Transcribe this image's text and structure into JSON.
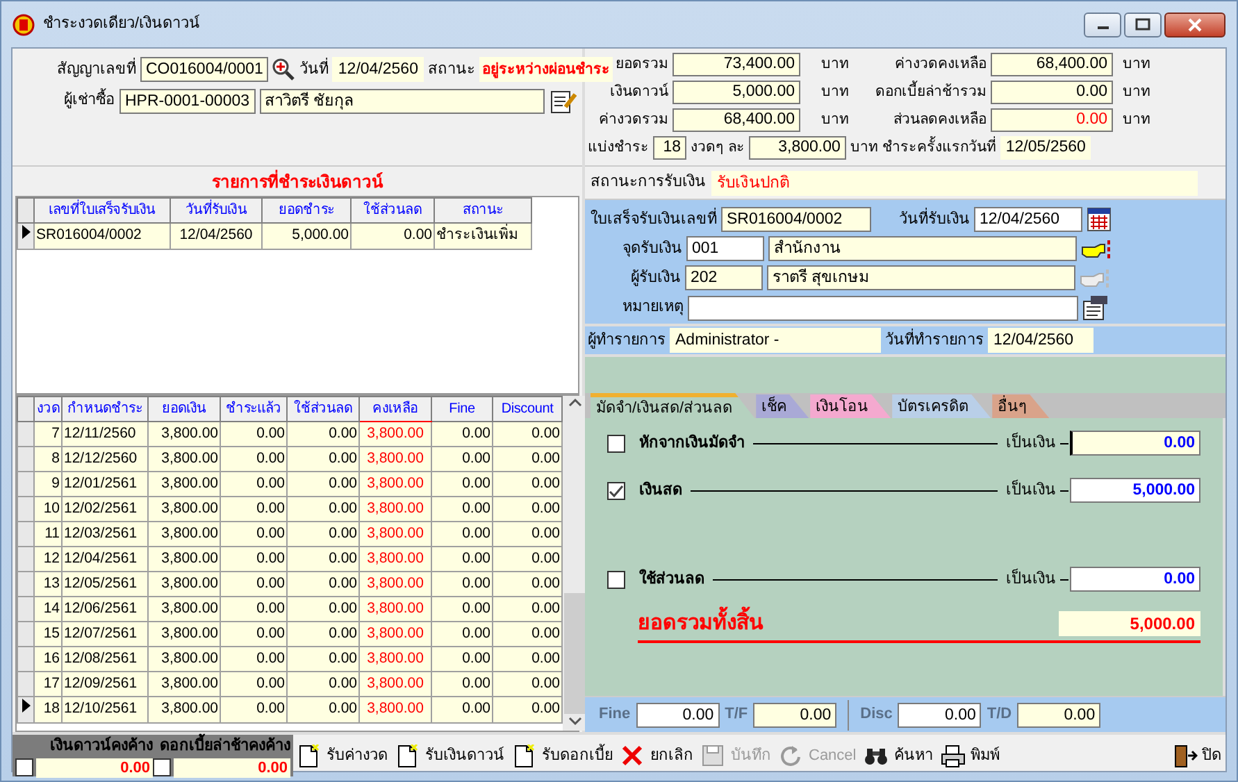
{
  "window": {
    "title": "ชำระงวดเดียว/เงินดาวน์"
  },
  "contract": {
    "number_label": "สัญญาเลขที่",
    "number": "CO016004/0001",
    "date_label": "วันที่",
    "date": "12/04/2560",
    "status_label": "สถานะ",
    "status": "อยู่ระหว่างผ่อนชำระ",
    "buyer_label": "ผู้เช่าซื้อ",
    "buyer_code": "HPR-0001-00003",
    "buyer_name": "สาวิตรี  ชัยกุล"
  },
  "totals": [
    {
      "label": "ยอดรวม",
      "value": "73,400.00",
      "unit": "บาท",
      "alert": false
    },
    {
      "label": "ค่างวดคงเหลือ",
      "value": "68,400.00",
      "unit": "บาท",
      "alert": false
    },
    {
      "label": "เงินดาวน์",
      "value": "5,000.00",
      "unit": "บาท",
      "alert": false
    },
    {
      "label": "ดอกเบี้ยล่าช้ารวม",
      "value": "0.00",
      "unit": "บาท",
      "alert": false
    },
    {
      "label": "ค่างวดรวม",
      "value": "68,400.00",
      "unit": "บาท",
      "alert": false
    },
    {
      "label": "ส่วนลดคงเหลือ",
      "value": "0.00",
      "unit": "บาท",
      "alert": true
    }
  ],
  "plan": {
    "label": "แบ่งชำระ",
    "count": "18",
    "each_label": "งวดๆ ละ",
    "amount": "3,800.00",
    "first_label": "บาท ชำระครั้งแรกวันที่",
    "first_date": "12/05/2560"
  },
  "payments": {
    "title": "รายการที่ชำระเงินดาวน์",
    "columns": [
      "เลขที่ใบเสร็จรับเงิน",
      "วันที่รับเงิน",
      "ยอดชำระ",
      "ใช้ส่วนลด",
      "สถานะ"
    ],
    "rows": [
      {
        "current": true,
        "cells": [
          "SR016004/0002",
          "12/04/2560",
          "5,000.00",
          "0.00",
          "ชำระเงินเพิ่ม"
        ]
      }
    ]
  },
  "receipt_status": {
    "label": "สถานะการรับเงิน",
    "value": "รับเงินปกติ"
  },
  "receipt": {
    "number_label": "ใบเสร็จรับเงินเลขที่",
    "number": "SR016004/0002",
    "date_label": "วันที่รับเงิน",
    "date": "12/04/2560",
    "point_label": "จุดรับเงิน",
    "point_code": "001",
    "point_name": "สำนักงาน",
    "receiver_label": "ผู้รับเงิน",
    "receiver_code": "202",
    "receiver_name": "ราตรี สุขเกษม",
    "note_label": "หมายเหตุ"
  },
  "operator": {
    "label": "ผู้ทำรายการ",
    "value": "Administrator -",
    "date_label": "วันที่ทำรายการ",
    "date": "12/04/2560"
  },
  "tabs": [
    {
      "label": "มัดจำ/เงินสด/ส่วนลด",
      "color": "#b5d1bf",
      "selected": true
    },
    {
      "label": "เช็ค",
      "color": "#a9a9d6",
      "selected": false
    },
    {
      "label": "เงินโอน",
      "color": "#f4a9cf",
      "selected": false
    },
    {
      "label": "บัตรเครดิต",
      "color": "#b9cfe8",
      "selected": false
    },
    {
      "label": "อื่นๆ",
      "color": "#d9a38a",
      "selected": false
    }
  ],
  "payment_lines": [
    {
      "label": "หักจากเงินมัดจำ",
      "checked": false,
      "amount_label": "เป็นเงิน",
      "amount": "0.00",
      "focused": true
    },
    {
      "label": "เงินสด",
      "checked": true,
      "amount_label": "เป็นเงิน",
      "amount": "5,000.00",
      "focused": false
    },
    {
      "label": "ใช้ส่วนลด",
      "checked": false,
      "amount_label": "เป็นเงิน",
      "amount": "0.00",
      "focused": false
    }
  ],
  "grand_total": {
    "label": "ยอดรวมทั้งสิ้น",
    "value": "5,000.00"
  },
  "adjustments": [
    {
      "label": "Fine",
      "value": "0.00"
    },
    {
      "label": "T/F",
      "value": "0.00"
    },
    {
      "label": "Disc",
      "value": "0.00"
    },
    {
      "label": "T/D",
      "value": "0.00"
    }
  ],
  "installments": {
    "columns": [
      {
        "label": "งวด",
        "alert": false
      },
      {
        "label": "กำหนดชำระ",
        "alert": false
      },
      {
        "label": "ยอดเงิน",
        "alert": false
      },
      {
        "label": "ชำระแล้ว",
        "alert": false
      },
      {
        "label": "ใช้ส่วนลด",
        "alert": false
      },
      {
        "label": "คงเหลือ",
        "alert": true
      },
      {
        "label": "Fine",
        "alert": false
      },
      {
        "label": "Discount",
        "alert": false
      }
    ],
    "rows": [
      {
        "current": false,
        "cells": [
          "7",
          "12/11/2560",
          "3,800.00",
          "0.00",
          "0.00",
          "3,800.00",
          "0.00",
          "0.00"
        ]
      },
      {
        "current": false,
        "cells": [
          "8",
          "12/12/2560",
          "3,800.00",
          "0.00",
          "0.00",
          "3,800.00",
          "0.00",
          "0.00"
        ]
      },
      {
        "current": false,
        "cells": [
          "9",
          "12/01/2561",
          "3,800.00",
          "0.00",
          "0.00",
          "3,800.00",
          "0.00",
          "0.00"
        ]
      },
      {
        "current": false,
        "cells": [
          "10",
          "12/02/2561",
          "3,800.00",
          "0.00",
          "0.00",
          "3,800.00",
          "0.00",
          "0.00"
        ]
      },
      {
        "current": false,
        "cells": [
          "11",
          "12/03/2561",
          "3,800.00",
          "0.00",
          "0.00",
          "3,800.00",
          "0.00",
          "0.00"
        ]
      },
      {
        "current": false,
        "cells": [
          "12",
          "12/04/2561",
          "3,800.00",
          "0.00",
          "0.00",
          "3,800.00",
          "0.00",
          "0.00"
        ]
      },
      {
        "current": false,
        "cells": [
          "13",
          "12/05/2561",
          "3,800.00",
          "0.00",
          "0.00",
          "3,800.00",
          "0.00",
          "0.00"
        ]
      },
      {
        "current": false,
        "cells": [
          "14",
          "12/06/2561",
          "3,800.00",
          "0.00",
          "0.00",
          "3,800.00",
          "0.00",
          "0.00"
        ]
      },
      {
        "current": false,
        "cells": [
          "15",
          "12/07/2561",
          "3,800.00",
          "0.00",
          "0.00",
          "3,800.00",
          "0.00",
          "0.00"
        ]
      },
      {
        "current": false,
        "cells": [
          "16",
          "12/08/2561",
          "3,800.00",
          "0.00",
          "0.00",
          "3,800.00",
          "0.00",
          "0.00"
        ]
      },
      {
        "current": false,
        "cells": [
          "17",
          "12/09/2561",
          "3,800.00",
          "0.00",
          "0.00",
          "3,800.00",
          "0.00",
          "0.00"
        ]
      },
      {
        "current": true,
        "cells": [
          "18",
          "12/10/2561",
          "3,800.00",
          "0.00",
          "0.00",
          "3,800.00",
          "0.00",
          "0.00"
        ]
      }
    ]
  },
  "outstanding": [
    {
      "label": "เงินดาวน์คงค้าง",
      "value": "0.00",
      "checked": false
    },
    {
      "label": "ดอกเบี้ยล่าช้าคงค้าง",
      "value": "0.00",
      "checked": false
    }
  ],
  "toolbar": [
    {
      "label": "รับค่างวด",
      "kind": "new",
      "disabled": false
    },
    {
      "label": "รับเงินดาวน์",
      "kind": "new",
      "disabled": false
    },
    {
      "label": "รับดอกเบี้ย",
      "kind": "new",
      "disabled": false
    },
    {
      "label": "ยกเลิก",
      "kind": "delete",
      "disabled": false
    },
    {
      "label": "บันทึก",
      "kind": "save",
      "disabled": true
    },
    {
      "label": "Cancel",
      "kind": "undo",
      "disabled": true
    },
    {
      "label": "ค้นหา",
      "kind": "find",
      "disabled": false
    },
    {
      "label": "พิมพ์",
      "kind": "print",
      "disabled": false
    },
    {
      "label": "ปิด",
      "kind": "exit",
      "disabled": false
    }
  ]
}
